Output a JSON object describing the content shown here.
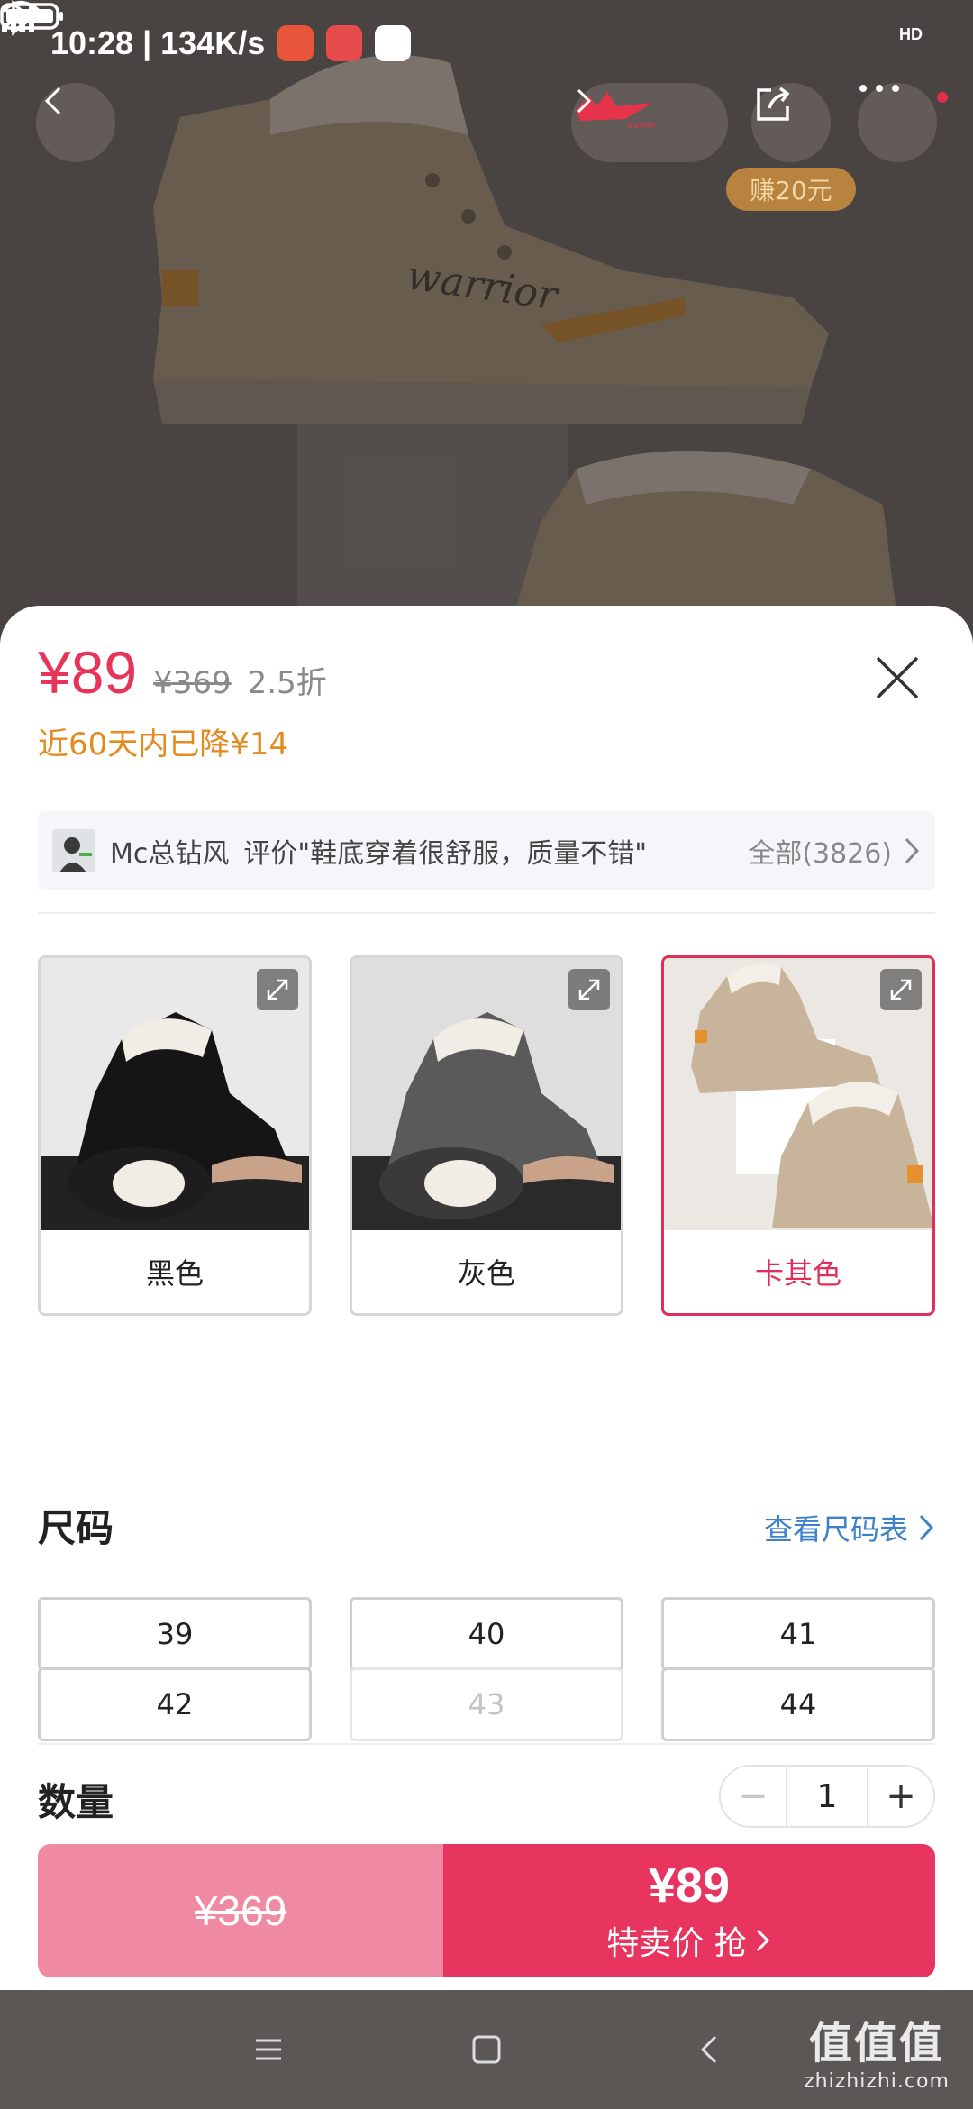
{
  "status_bar": {
    "time_speed": "10:28 | 134K/s",
    "network_label": "HD"
  },
  "hero": {
    "earn_badge": "赚20元",
    "brand_logo_text": "warrior",
    "shoe_text": "warrior"
  },
  "price": {
    "current": "¥89",
    "original": "¥369",
    "discount": "2.5折",
    "drop_note": "近60天内已降¥14"
  },
  "review": {
    "user": "Mc总钻风",
    "text": "评价\"鞋底穿着很舒服，质量不错\"",
    "all_label": "全部(3826)"
  },
  "colors": [
    {
      "label": "黑色",
      "selected": false
    },
    {
      "label": "灰色",
      "selected": false
    },
    {
      "label": "卡其色",
      "selected": true
    }
  ],
  "size": {
    "title": "尺码",
    "chart_link": "查看尺码表",
    "options": [
      {
        "label": "39",
        "available": true
      },
      {
        "label": "40",
        "available": true
      },
      {
        "label": "41",
        "available": true
      },
      {
        "label": "42",
        "available": true
      },
      {
        "label": "43",
        "available": false
      },
      {
        "label": "44",
        "available": true
      }
    ]
  },
  "quantity": {
    "title": "数量",
    "minus": "−",
    "value": "1",
    "plus": "+"
  },
  "buy": {
    "original_price": "¥369",
    "special_price": "¥89",
    "special_label": "特卖价 抢"
  },
  "watermark": {
    "main": "值值值",
    "sub": "zhizhizhi.com"
  },
  "colors_theme": {
    "accent": "#e8355f",
    "accent_light": "#f08aa2",
    "price_drop": "#e38b1f",
    "link": "#3d82c8"
  }
}
